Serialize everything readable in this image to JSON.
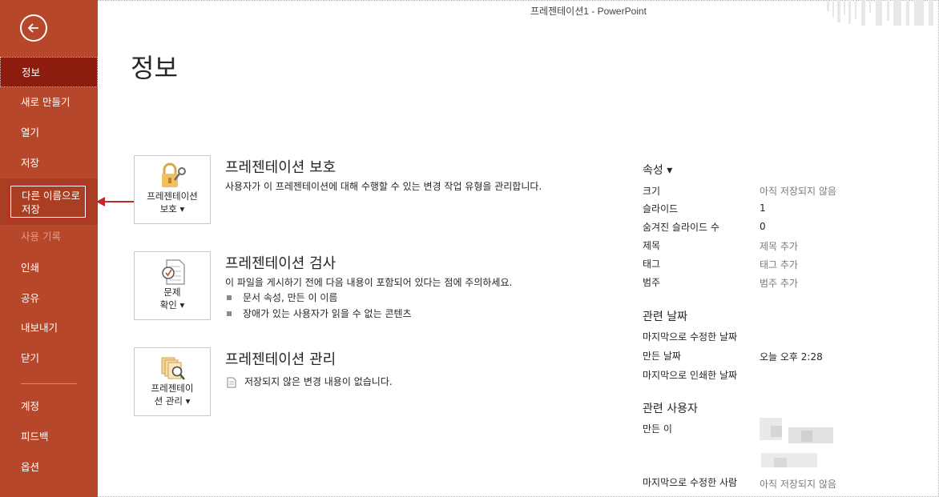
{
  "window": {
    "title": "프레젠테이션1  -  PowerPoint"
  },
  "sidebar": {
    "items": [
      {
        "label": "정보",
        "state": "active"
      },
      {
        "label": "새로 만들기"
      },
      {
        "label": "열기"
      },
      {
        "label": "저장"
      },
      {
        "label_line1": "다른 이름으로",
        "label_line2": "저장",
        "state": "highlighted"
      },
      {
        "label": "사용 기록",
        "state": "disabled"
      },
      {
        "label": "인쇄"
      },
      {
        "label": "공유"
      },
      {
        "label": "내보내기"
      },
      {
        "label": "닫기"
      },
      {
        "label": "계정"
      },
      {
        "label": "피드백"
      },
      {
        "label": "옵션"
      }
    ],
    "back_icon": "back-arrow-icon",
    "accent_color": "#b7472a"
  },
  "main": {
    "title": "정보",
    "sections": [
      {
        "button_line1": "프레젠테이션",
        "button_line2": "보호 ▾",
        "icon": "lock-key-icon",
        "title": "프레젠테이션 보호",
        "description": "사용자가 이 프레젠테이션에 대해 수행할 수 있는 변경 작업 유형을 관리합니다."
      },
      {
        "button_line1": "문제",
        "button_line2": "확인 ▾",
        "icon": "document-check-icon",
        "title": "프레젠테이션 검사",
        "description": "이 파일을 게시하기 전에 다음 내용이 포함되어 있다는 점에 주의하세요.",
        "bullets": [
          "문서 속성, 만든 이 이름",
          "장애가 있는 사용자가 읽을 수 없는 콘텐츠"
        ]
      },
      {
        "button_line1": "프레젠테이",
        "button_line2": "션 관리 ▾",
        "icon": "manage-versions-icon",
        "title": "프레젠테이션 관리",
        "description": "저장되지 않은 변경 내용이 없습니다."
      }
    ]
  },
  "properties": {
    "heading": "속성 ▾",
    "rows": [
      {
        "label": "크기",
        "value": "아직 저장되지 않음"
      },
      {
        "label": "슬라이드",
        "value": "1"
      },
      {
        "label": "숨겨진 슬라이드 수",
        "value": "0"
      },
      {
        "label": "제목",
        "value": "제목 추가"
      },
      {
        "label": "태그",
        "value": "태그 추가"
      },
      {
        "label": "범주",
        "value": "범주 추가"
      }
    ],
    "dates_heading": "관련 날짜",
    "dates": [
      {
        "label": "마지막으로 수정한 날짜",
        "value": ""
      },
      {
        "label": "만든 날짜",
        "value": "오늘 오후 2:28"
      },
      {
        "label": "마지막으로 인쇄한 날짜",
        "value": ""
      }
    ],
    "people_heading": "관련 사용자",
    "people": [
      {
        "label": "만든 이"
      },
      {
        "label": "마지막으로 수정한 사람",
        "value": "아직 저장되지 않음"
      }
    ]
  }
}
